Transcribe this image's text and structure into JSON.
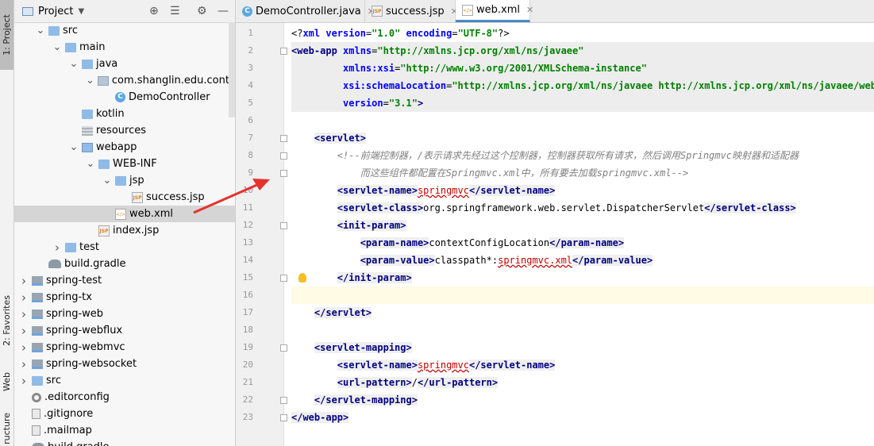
{
  "toolstrip": {
    "project_tab": "1: Project",
    "favorites_tab": "2: Favorites",
    "web_tab": "Web",
    "structure_tab": "ructure"
  },
  "project_panel": {
    "title": "Project",
    "tree": [
      {
        "label": "src",
        "depth": 2,
        "icon": "folder-icon",
        "expanded": true
      },
      {
        "label": "main",
        "depth": 3,
        "icon": "folder-icon",
        "expanded": true
      },
      {
        "label": "java",
        "depth": 4,
        "icon": "source-folder-icon",
        "expanded": true
      },
      {
        "label": "com.shanglin.edu.contro",
        "depth": 5,
        "icon": "package-icon",
        "expanded": true
      },
      {
        "label": "DemoController",
        "depth": 6,
        "icon": "class-icon"
      },
      {
        "label": "kotlin",
        "depth": 4,
        "icon": "folder-icon"
      },
      {
        "label": "resources",
        "depth": 4,
        "icon": "resources-folder-icon"
      },
      {
        "label": "webapp",
        "depth": 4,
        "icon": "web-folder-icon",
        "expanded": true
      },
      {
        "label": "WEB-INF",
        "depth": 5,
        "icon": "folder-icon",
        "expanded": true
      },
      {
        "label": "jsp",
        "depth": 6,
        "icon": "folder-icon",
        "expanded": true
      },
      {
        "label": "success.jsp",
        "depth": 7,
        "icon": "jsp-file-icon"
      },
      {
        "label": "web.xml",
        "depth": 6,
        "icon": "xml-file-icon",
        "selected": true
      },
      {
        "label": "index.jsp",
        "depth": 5,
        "icon": "jsp-file-icon"
      },
      {
        "label": "test",
        "depth": 3,
        "icon": "folder-icon",
        "collapsed": true
      },
      {
        "label": "build.gradle",
        "depth": 2,
        "icon": "gradle-icon"
      },
      {
        "label": "spring-test",
        "depth": 1,
        "icon": "module-icon",
        "collapsed": true
      },
      {
        "label": "spring-tx",
        "depth": 1,
        "icon": "module-icon",
        "collapsed": true
      },
      {
        "label": "spring-web",
        "depth": 1,
        "icon": "module-icon",
        "collapsed": true
      },
      {
        "label": "spring-webflux",
        "depth": 1,
        "icon": "module-icon",
        "collapsed": true
      },
      {
        "label": "spring-webmvc",
        "depth": 1,
        "icon": "module-icon",
        "collapsed": true
      },
      {
        "label": "spring-websocket",
        "depth": 1,
        "icon": "module-icon",
        "collapsed": true
      },
      {
        "label": "src",
        "depth": 1,
        "icon": "folder-icon",
        "collapsed": true
      },
      {
        "label": ".editorconfig",
        "depth": 1,
        "icon": "config-icon"
      },
      {
        "label": ".gitignore",
        "depth": 1,
        "icon": "file-icon"
      },
      {
        "label": ".mailmap",
        "depth": 1,
        "icon": "file-icon"
      },
      {
        "label": "build.gradle",
        "depth": 1,
        "icon": "gradle-icon"
      }
    ]
  },
  "tabs": [
    {
      "label": "DemoController.java",
      "icon": "class-icon"
    },
    {
      "label": "success.jsp",
      "icon": "jsp-file-icon"
    },
    {
      "label": "web.xml",
      "icon": "xml-file-icon",
      "active": true
    }
  ],
  "editor": {
    "line_numbers": [
      "1",
      "2",
      "3",
      "4",
      "5",
      "6",
      "7",
      "8",
      "9",
      "10",
      "11",
      "12",
      "13",
      "14",
      "15",
      "16",
      "17",
      "18",
      "19",
      "20",
      "21",
      "22",
      "23"
    ],
    "lines": [
      [
        [
          "tx",
          "<?"
        ],
        [
          "an",
          "xml "
        ],
        [
          "an",
          "version"
        ],
        [
          "tx",
          "="
        ],
        [
          "av",
          "\"1.0\" "
        ],
        [
          "an",
          "encoding"
        ],
        [
          "tx",
          "="
        ],
        [
          "av",
          "\"UTF-8\""
        ],
        [
          "tx",
          "?>"
        ]
      ],
      [
        [
          "tg",
          "<web-app "
        ],
        [
          "an",
          "xmlns"
        ],
        [
          "tx",
          "="
        ],
        [
          "av",
          "\"http://xmlns.jcp.org/xml/ns/javaee\""
        ]
      ],
      [
        [
          "tx",
          "         "
        ],
        [
          "an",
          "xmlns:xsi"
        ],
        [
          "tx",
          "="
        ],
        [
          "av",
          "\"http://www.w3.org/2001/XMLSchema-instance\""
        ]
      ],
      [
        [
          "tx",
          "         "
        ],
        [
          "an",
          "xsi:schemaLocation"
        ],
        [
          "tx",
          "="
        ],
        [
          "av",
          "\"http://xmlns.jcp.org/xml/ns/javaee http://xmlns.jcp.org/xml/ns/javaee/web-ap"
        ]
      ],
      [
        [
          "tx",
          "         "
        ],
        [
          "an",
          "version"
        ],
        [
          "tx",
          "="
        ],
        [
          "av",
          "\"3.1\""
        ],
        [
          "tg",
          ">"
        ]
      ],
      [],
      [
        [
          "tx",
          "    "
        ],
        [
          "tg",
          "<servlet>"
        ]
      ],
      [
        [
          "tx",
          "        "
        ],
        [
          "cm",
          "<!--前端控制器，/表示请求先经过这个控制器，控制器获取所有请求，然后调用Springmvc映射器和适配器"
        ]
      ],
      [
        [
          "tx",
          "            "
        ],
        [
          "cm",
          "而这些组件都配置在Springmvc.xml中，所有要去加载springmvc.xml-->"
        ]
      ],
      [
        [
          "tx",
          "        "
        ],
        [
          "tg",
          "<servlet-name>"
        ],
        [
          "err",
          "springmvc"
        ],
        [
          "tg",
          "</servlet-name>"
        ]
      ],
      [
        [
          "tx",
          "        "
        ],
        [
          "tg",
          "<servlet-class>"
        ],
        [
          "tx",
          "org.springframework.web.servlet.DispatcherServlet"
        ],
        [
          "tg",
          "</servlet-class>"
        ]
      ],
      [
        [
          "tx",
          "        "
        ],
        [
          "tg",
          "<init-param>"
        ]
      ],
      [
        [
          "tx",
          "            "
        ],
        [
          "tg",
          "<param-name>"
        ],
        [
          "tx",
          "contextConfigLocation"
        ],
        [
          "tg",
          "</param-name>"
        ]
      ],
      [
        [
          "tx",
          "            "
        ],
        [
          "tg",
          "<param-value>"
        ],
        [
          "tx",
          "classpath*:"
        ],
        [
          "err",
          "springmvc.xml"
        ],
        [
          "tg",
          "</param-value>"
        ]
      ],
      [
        [
          "tx",
          "        "
        ],
        [
          "tg",
          "</init-param>"
        ]
      ],
      [],
      [
        [
          "tx",
          "    "
        ],
        [
          "tg",
          "</servlet>"
        ]
      ],
      [],
      [
        [
          "tx",
          "    "
        ],
        [
          "tg",
          "<servlet-mapping>"
        ]
      ],
      [
        [
          "tx",
          "        "
        ],
        [
          "tg",
          "<servlet-name>"
        ],
        [
          "err",
          "springmvc"
        ],
        [
          "tg",
          "</servlet-name>"
        ]
      ],
      [
        [
          "tx",
          "        "
        ],
        [
          "tg",
          "<url-pattern>"
        ],
        [
          "tx",
          "/"
        ],
        [
          "tg",
          "</url-pattern>"
        ]
      ],
      [
        [
          "tx",
          "    "
        ],
        [
          "tg",
          "</servlet-mapping>"
        ]
      ],
      [
        [
          "tg",
          "</web-app>"
        ]
      ]
    ]
  }
}
